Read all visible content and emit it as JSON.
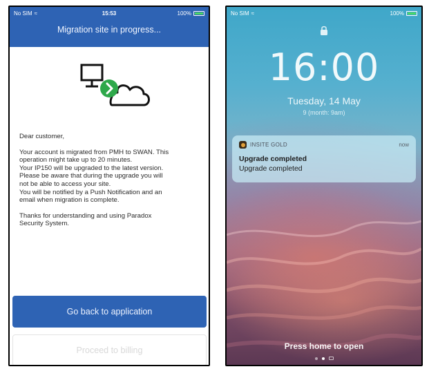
{
  "left_screen": {
    "status": {
      "carrier": "No SIM",
      "time": "15:53",
      "battery": "100%"
    },
    "title": "Migration site in progress...",
    "greeting": "Dear customer,",
    "body_lines_1": [
      " Your account is migrated from PMH to SWAN. This",
      "operation might take up to 20 minutes.",
      "Your IP150 will be upgraded to the latest version.",
      "Please be aware that during the upgrade you will",
      "not be able to access your site.",
      "You will be notified by a Push Notification and an",
      "email when migration is complete."
    ],
    "body_lines_2": [
      "Thanks for understanding and using Paradox",
      "Security System."
    ],
    "primary_button": "Go back to application",
    "secondary_button": "Proceed to billing",
    "colors": {
      "header": "#2e63b4",
      "accent_green": "#2ea84a"
    }
  },
  "right_screen": {
    "status": {
      "carrier": "No SIM",
      "battery": "100%"
    },
    "time": "16:00",
    "date": "Tuesday, 14 May",
    "lunar": "9 (month: 9am)",
    "notification": {
      "app": "INSITE GOLD",
      "time": "now",
      "title": "Upgrade completed",
      "text": "Upgrade completed"
    },
    "unlock_hint": "Press home to open"
  }
}
